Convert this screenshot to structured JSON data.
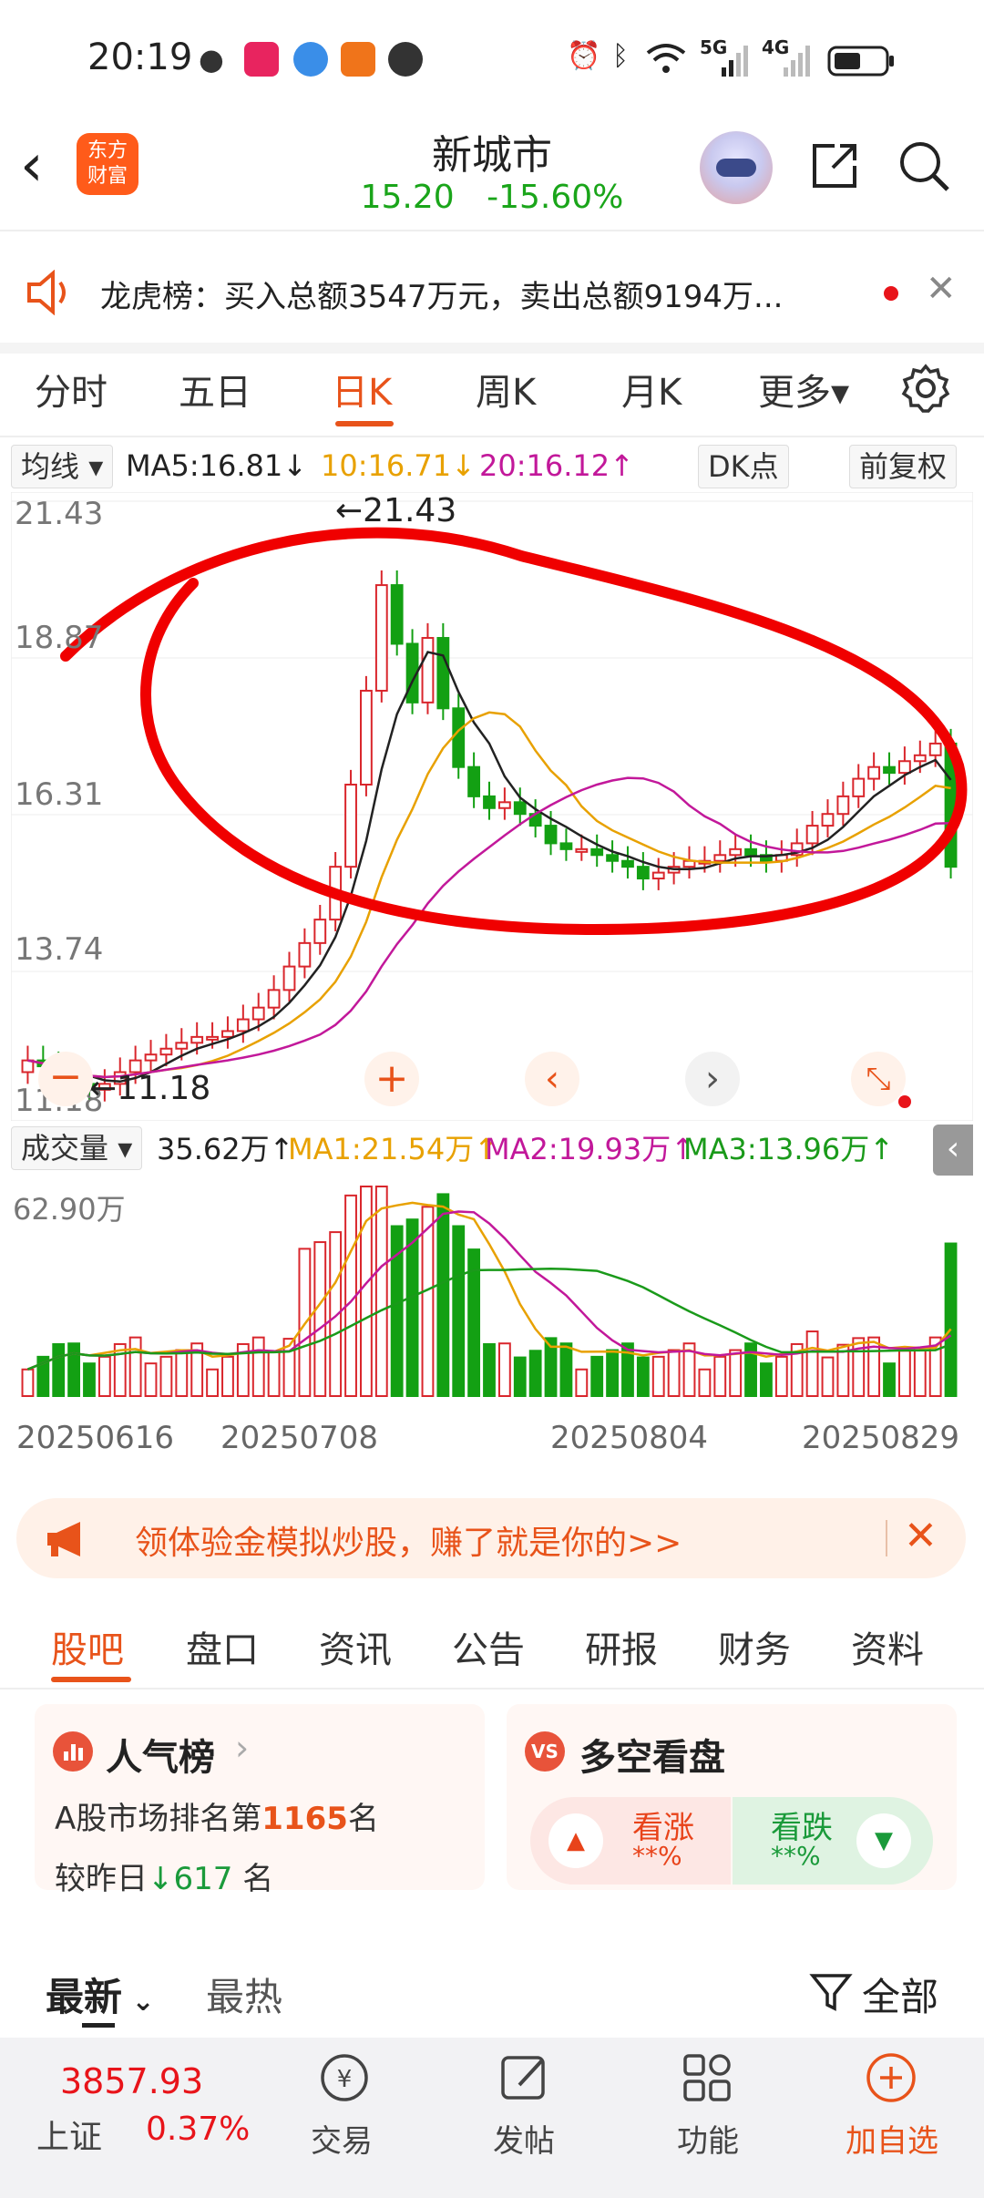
{
  "status_bar": {
    "time": "20:19",
    "icons": [
      "wechat-icon",
      "video-app-icon",
      "browser-icon",
      "shopping-app-icon",
      "pause-app-icon",
      "alarm-icon",
      "bluetooth-icon",
      "wifi-icon",
      "signal-5g-icon",
      "signal-4g-icon",
      "battery-icon"
    ],
    "net1": "5G",
    "net2": "4G"
  },
  "header": {
    "back_icon": "back-arrow-icon",
    "logo_line1": "东方",
    "logo_line2": "财富",
    "stock_name": "新城市",
    "price": "15.20",
    "change_pct": "-15.60%",
    "assistant_icon": "robot-assistant-icon",
    "share_icon": "share-icon",
    "search_icon": "search-icon"
  },
  "notice": {
    "icon": "speaker-icon",
    "text": "龙虎榜：买入总额3547万元，卖出总额9194万..."
  },
  "chart_tabs": {
    "items": [
      "分时",
      "五日",
      "日K",
      "周K",
      "月K",
      "更多▾"
    ],
    "active_index": 2
  },
  "ma_bar": {
    "selector": "均线",
    "ma5": "MA5:16.81↓",
    "ma10": "10:16.71↓",
    "ma20": "20:16.12↑",
    "dk": "DK点",
    "adjust": "前复权"
  },
  "kline": {
    "y_labels": [
      "21.43",
      "18.87",
      "16.31",
      "13.74",
      "11.18"
    ],
    "high_marker": "←21.43",
    "low_marker": "←11.18",
    "controls": [
      "minus-icon",
      "plus-icon",
      "chevron-left-icon",
      "chevron-right-icon",
      "expand-icon"
    ]
  },
  "volume": {
    "selector": "成交量",
    "value": "35.62万↑",
    "ma1": "MA1:21.54万↑",
    "ma2": "MA2:19.93万↑",
    "ma3": "MA3:13.96万↑",
    "max_label": "62.90万",
    "collapse_icon": "chevron-left-icon"
  },
  "dates": [
    "20250616",
    "20250708",
    "20250804",
    "20250829"
  ],
  "promo": {
    "icon": "megaphone-icon",
    "text": "领体验金模拟炒股，赚了就是你的>>",
    "close_icon": "close-icon"
  },
  "sub_tabs": {
    "items": [
      "股吧",
      "盘口",
      "资讯",
      "公告",
      "研报",
      "财务",
      "资料"
    ],
    "active_index": 0
  },
  "popularity": {
    "title": "人气榜",
    "rank_prefix": "A股市场排名第",
    "rank": "1165",
    "rank_suffix": "名",
    "change_prefix": "较昨日",
    "change": "617",
    "change_suffix": "名"
  },
  "sentiment": {
    "title": "多空看盘",
    "bull_label": "看涨",
    "bull_value": "**%",
    "bear_label": "看跌",
    "bear_value": "**%"
  },
  "feed": {
    "latest": "最新",
    "hot": "最热",
    "filter": "全部"
  },
  "bottom_bar": {
    "index_value": "3857.93",
    "index_name": "上证",
    "index_change": "0.37%",
    "trade": "交易",
    "post": "发帖",
    "functions": "功能",
    "add_watch": "加自选"
  },
  "chart_data": {
    "type": "candlestick",
    "y_range": [
      11.18,
      21.43
    ],
    "high": 21.43,
    "low": 11.18,
    "ma_lines": [
      "MA5",
      "MA10",
      "MA20"
    ],
    "x_labels": [
      "20250616",
      "20250708",
      "20250804",
      "20250829"
    ],
    "volume_max": "62.90万"
  }
}
